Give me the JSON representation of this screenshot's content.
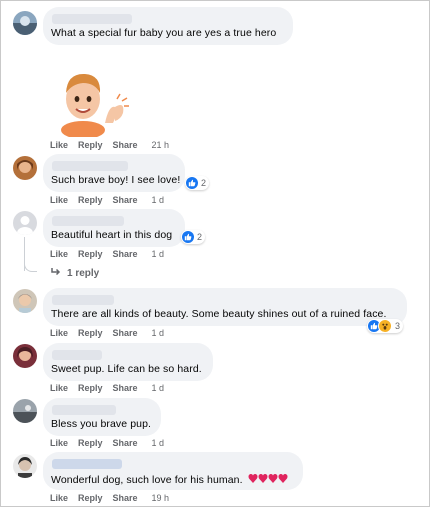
{
  "comments": [
    {
      "text": "What a special fur baby you are yes a true hero",
      "time": "21 h"
    },
    {
      "text": "Such brave boy! I see love!",
      "time": "1 d",
      "reactions": "2"
    },
    {
      "text": "Beautiful heart in this dog",
      "time": "1 d",
      "reactions": "2",
      "replies": "1 reply"
    },
    {
      "text": "There are all kinds of beauty. Some beauty shines out of a ruined face.",
      "time": "1 d",
      "reactions": "3"
    },
    {
      "text": "Sweet pup. Life can be so hard.",
      "time": "1 d"
    },
    {
      "text": "Bless you brave pup.",
      "time": "1 d"
    },
    {
      "text": "Wonderful dog, such love for his human.",
      "time": "19 h"
    }
  ],
  "actions": {
    "like": "Like",
    "reply": "Reply",
    "share": "Share"
  },
  "colors": {
    "bubble": "#f0f2f5",
    "like_blue": "#1877f2",
    "meta": "#65676b",
    "heart": "#e0245e"
  }
}
